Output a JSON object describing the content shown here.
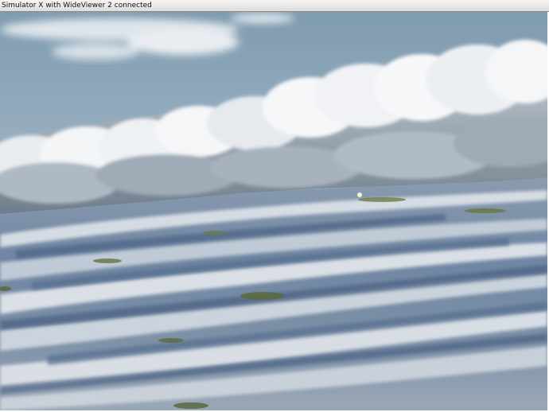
{
  "window": {
    "title": "Simulator X with WideViewer 2 connected"
  },
  "scene": {
    "description_icon": "landscape-view",
    "colors": {
      "sky_top": "#8aa3b6",
      "sky_bottom": "#b7c5ce",
      "cloud_light": "#f2f3f4",
      "cloud_shadow": "#7d8b98",
      "ground_blue": "#5f7896",
      "ground_light": "#d9dde2"
    }
  }
}
